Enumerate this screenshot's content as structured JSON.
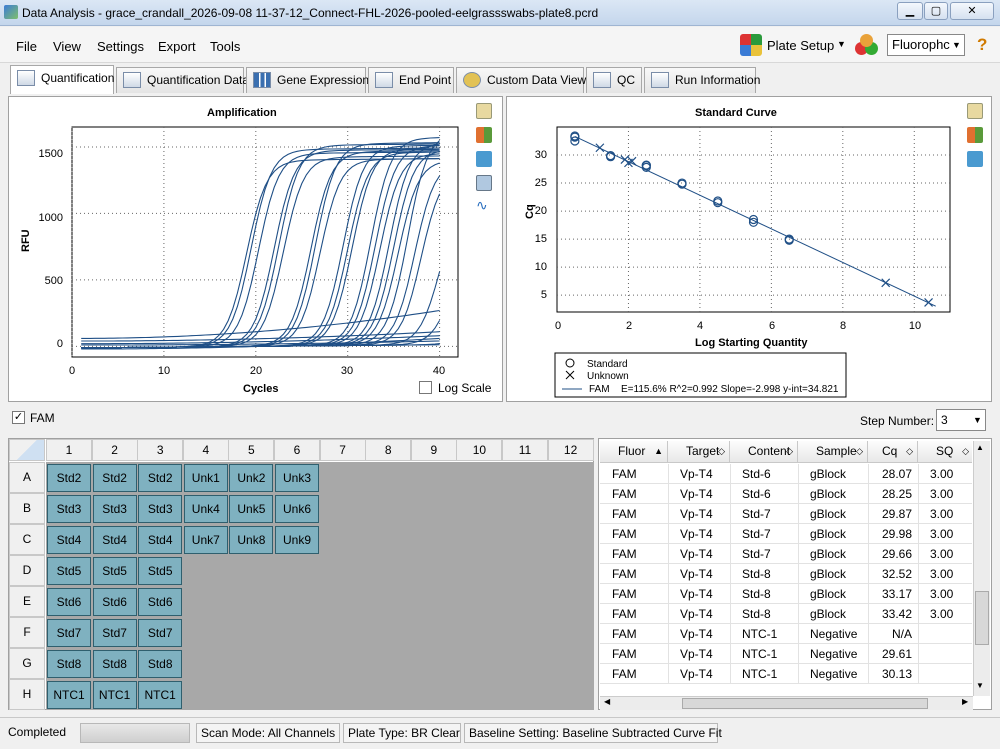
{
  "window": {
    "title": "Data Analysis - grace_crandall_2026-09-08 11-37-12_Connect-FHL-2026-pooled-eelgrassswabs-plate8.pcrd"
  },
  "menu": [
    "File",
    "View",
    "Settings",
    "Export",
    "Tools"
  ],
  "toolbar": {
    "plate_setup": "Plate Setup",
    "fluorophore": "Fluorophc",
    "help": "?"
  },
  "tabs": [
    "Quantification",
    "Quantification Data",
    "Gene Expression",
    "End Point",
    "Custom Data View",
    "QC",
    "Run Information"
  ],
  "amplification": {
    "title": "Amplification",
    "xlabel": "Cycles",
    "ylabel": "RFU",
    "yticks": [
      "1500",
      "1000",
      "500",
      "0"
    ],
    "xticks": [
      "0",
      "10",
      "20",
      "30",
      "40"
    ],
    "log_scale": "Log Scale"
  },
  "standard_curve": {
    "title": "Standard Curve",
    "xlabel": "Log Starting Quantity",
    "ylabel": "Cq",
    "yticks": [
      "30",
      "25",
      "20",
      "15",
      "10",
      "5"
    ],
    "xticks": [
      "0",
      "2",
      "4",
      "6",
      "8",
      "10"
    ],
    "legend": {
      "standard": "Standard",
      "unknown": "Unknown",
      "fam": "FAM",
      "stats": "E=115.6% R^2=0.992 Slope=-2.998 y-int=34.821"
    }
  },
  "chart_data": [
    {
      "type": "line",
      "title": "Amplification",
      "xlabel": "Cycles",
      "ylabel": "RFU",
      "xlim": [
        0,
        42
      ],
      "ylim": [
        -80,
        1650
      ],
      "grid": true,
      "series_note": "",
      "x_range": [
        1,
        40
      ],
      "curves": [
        {
          "ct": 16.5,
          "plateau": 1400
        },
        {
          "ct": 17,
          "plateau": 1480
        },
        {
          "ct": 17.8,
          "plateau": 1450
        },
        {
          "ct": 19.5,
          "plateau": 1470
        },
        {
          "ct": 20,
          "plateau": 1510
        },
        {
          "ct": 20.5,
          "plateau": 1420
        },
        {
          "ct": 23.5,
          "plateau": 1460
        },
        {
          "ct": 24,
          "plateau": 1520
        },
        {
          "ct": 24.5,
          "plateau": 1400
        },
        {
          "ct": 27,
          "plateau": 1500
        },
        {
          "ct": 27.5,
          "plateau": 1450
        },
        {
          "ct": 28,
          "plateau": 1480
        },
        {
          "ct": 30,
          "plateau": 1560
        },
        {
          "ct": 30.5,
          "plateau": 1500
        },
        {
          "ct": 31,
          "plateau": 1440
        },
        {
          "ct": 32,
          "plateau": 1520
        },
        {
          "ct": 32.5,
          "plateau": 1470
        },
        {
          "ct": 33,
          "plateau": 1390
        },
        {
          "ct": 34,
          "plateau": 1600
        },
        {
          "ct": 34.8,
          "plateau": 1380
        },
        {
          "ct": 35.5,
          "plateau": 1320
        },
        {
          "ct": 37.5,
          "plateau": 1100
        },
        {
          "ct": 39,
          "plateau": 900
        },
        {
          "ct": 42,
          "plateau": 600
        },
        {
          "ct": 45,
          "plateau": 400
        }
      ],
      "flat_lines": [
        {
          "start": 60,
          "end": 270
        },
        {
          "start": 40,
          "end": 110
        },
        {
          "start": 20,
          "end": 80
        },
        {
          "start": -20,
          "end": 60
        },
        {
          "start": 10,
          "end": 40
        }
      ]
    },
    {
      "type": "scatter",
      "title": "Standard Curve",
      "xlabel": "Log Starting Quantity",
      "ylabel": "Cq",
      "xlim": [
        0,
        11
      ],
      "ylim": [
        2,
        35
      ],
      "grid": true,
      "standards": [
        [
          0.5,
          33.4
        ],
        [
          0.5,
          33.2
        ],
        [
          0.5,
          32.5
        ],
        [
          1.5,
          29.9
        ],
        [
          1.5,
          29.7
        ],
        [
          2.5,
          28.2
        ],
        [
          2.5,
          28.1
        ],
        [
          2.5,
          27.8
        ],
        [
          3.5,
          25.0
        ],
        [
          3.5,
          24.8
        ],
        [
          4.5,
          21.8
        ],
        [
          4.5,
          21.5
        ],
        [
          5.5,
          18.5
        ],
        [
          5.5,
          18.0
        ],
        [
          6.5,
          15.0
        ],
        [
          6.5,
          14.8
        ]
      ],
      "unknowns": [
        [
          1.2,
          31.3
        ],
        [
          1.9,
          29.2
        ],
        [
          2.0,
          28.6
        ],
        [
          2.1,
          28.9
        ],
        [
          9.2,
          7.2
        ],
        [
          10.4,
          3.7
        ]
      ],
      "fit": {
        "slope": -2.998,
        "intercept": 34.821
      }
    }
  ],
  "fluor_filter": {
    "checkbox": "FAM",
    "checked": true,
    "step_label": "Step Number:",
    "step_value": "3"
  },
  "plate": {
    "cols": [
      "1",
      "2",
      "3",
      "4",
      "5",
      "6",
      "7",
      "8",
      "9",
      "10",
      "11",
      "12"
    ],
    "rows": [
      "A",
      "B",
      "C",
      "D",
      "E",
      "F",
      "G",
      "H"
    ],
    "wells": [
      [
        "Std2",
        "Std2",
        "Std2",
        "Unk1",
        "Unk2",
        "Unk3"
      ],
      [
        "Std3",
        "Std3",
        "Std3",
        "Unk4",
        "Unk5",
        "Unk6"
      ],
      [
        "Std4",
        "Std4",
        "Std4",
        "Unk7",
        "Unk8",
        "Unk9"
      ],
      [
        "Std5",
        "Std5",
        "Std5"
      ],
      [
        "Std6",
        "Std6",
        "Std6"
      ],
      [
        "Std7",
        "Std7",
        "Std7"
      ],
      [
        "Std8",
        "Std8",
        "Std8"
      ],
      [
        "NTC1",
        "NTC1",
        "NTC1"
      ]
    ]
  },
  "table": {
    "headers": [
      "Fluor",
      "Target",
      "Content",
      "Sample",
      "Cq",
      "SQ"
    ],
    "rows": [
      [
        "FAM",
        "Vp-T4",
        "Std-6",
        "gBlock",
        "28.07",
        "3.00"
      ],
      [
        "FAM",
        "Vp-T4",
        "Std-6",
        "gBlock",
        "28.25",
        "3.00"
      ],
      [
        "FAM",
        "Vp-T4",
        "Std-7",
        "gBlock",
        "29.87",
        "3.00"
      ],
      [
        "FAM",
        "Vp-T4",
        "Std-7",
        "gBlock",
        "29.98",
        "3.00"
      ],
      [
        "FAM",
        "Vp-T4",
        "Std-7",
        "gBlock",
        "29.66",
        "3.00"
      ],
      [
        "FAM",
        "Vp-T4",
        "Std-8",
        "gBlock",
        "32.52",
        "3.00"
      ],
      [
        "FAM",
        "Vp-T4",
        "Std-8",
        "gBlock",
        "33.17",
        "3.00"
      ],
      [
        "FAM",
        "Vp-T4",
        "Std-8",
        "gBlock",
        "33.42",
        "3.00"
      ],
      [
        "FAM",
        "Vp-T4",
        "NTC-1",
        "Negative",
        "N/A",
        ""
      ],
      [
        "FAM",
        "Vp-T4",
        "NTC-1",
        "Negative",
        "29.61",
        ""
      ],
      [
        "FAM",
        "Vp-T4",
        "NTC-1",
        "Negative",
        "30.13",
        ""
      ]
    ]
  },
  "status": {
    "state": "Completed",
    "scan": "Scan Mode: All Channels",
    "plate_type": "Plate Type: BR Clear",
    "baseline": "Baseline Setting: Baseline Subtracted Curve Fit"
  }
}
